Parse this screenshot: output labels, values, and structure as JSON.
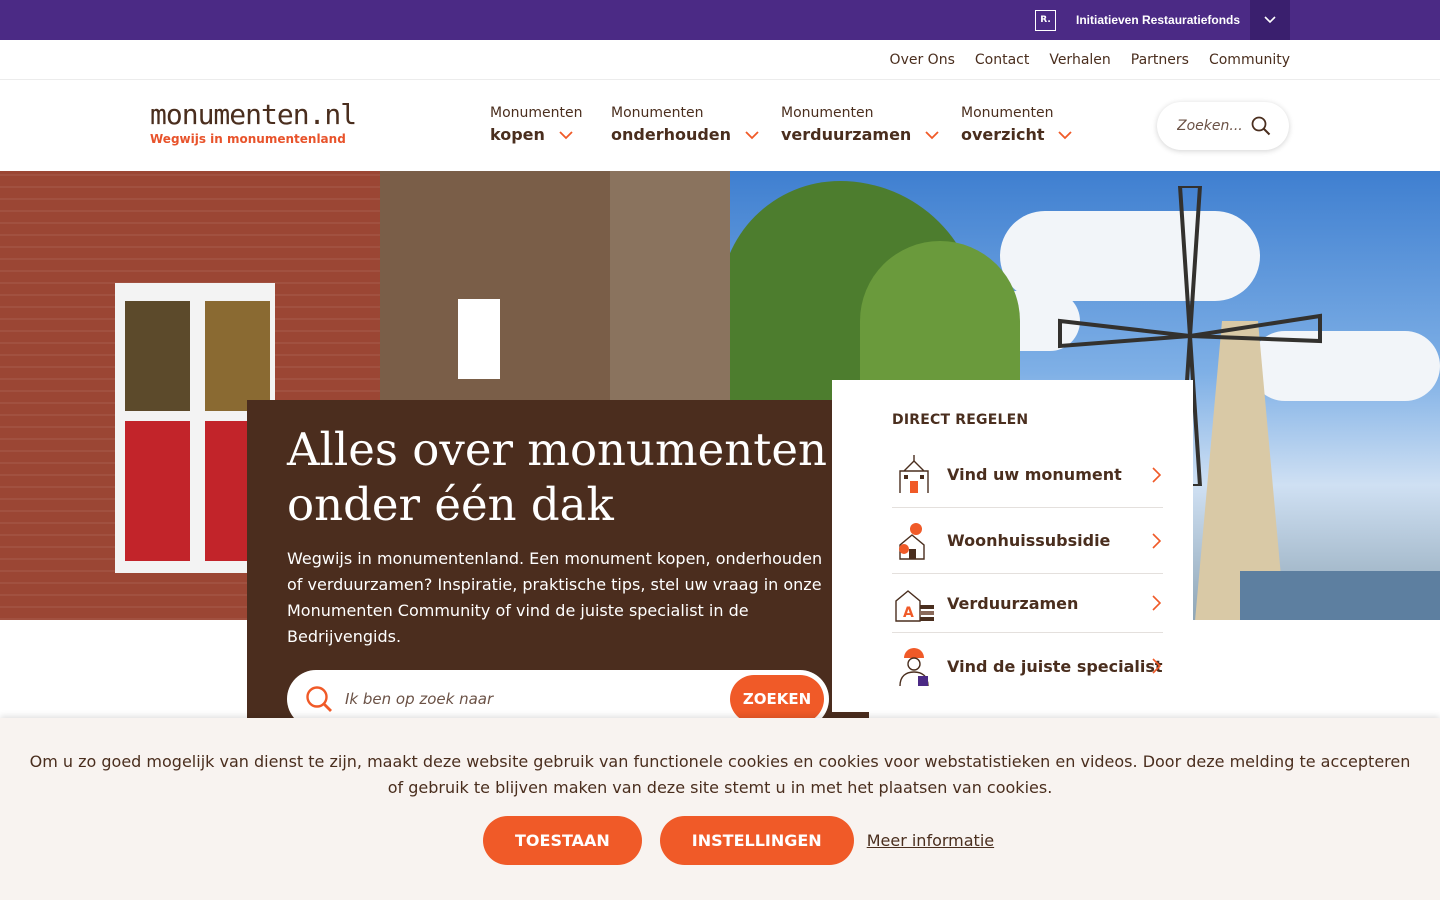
{
  "topbar": {
    "org_logo_text": "R.",
    "org_name": "Initiatieven Restauratiefonds",
    "toggle_icon": "chevron-down-icon"
  },
  "utility_nav": [
    "Over Ons",
    "Contact",
    "Verhalen",
    "Partners",
    "Community"
  ],
  "header": {
    "logo_text": "monumenten.nl",
    "logo_tagline": "Wegwijs in monumentenland",
    "nav": [
      {
        "small": "Monumenten",
        "big": "kopen"
      },
      {
        "small": "Monumenten",
        "big": "onderhouden"
      },
      {
        "small": "Monumenten",
        "big": "verduurzamen"
      },
      {
        "small": "Monumenten",
        "big": "overzicht"
      }
    ],
    "search_placeholder": "Zoeken..."
  },
  "hero": {
    "title": "Alles over monumenten onder één dak",
    "text": "Wegwijs in monumentenland. Een monument kopen, onderhouden of verduurzamen? Inspiratie, praktische tips, stel uw vraag in onze Monumenten Community of vind de juiste specialist in de Bedrijvengids.",
    "search_placeholder": "Ik ben op zoek naar",
    "search_button": "ZOEKEN"
  },
  "direct": {
    "title": "DIRECT REGELEN",
    "items": [
      {
        "label": "Vind uw monument",
        "icon": "monument-building-icon"
      },
      {
        "label": "Woonhuissubsidie",
        "icon": "subsidy-house-icon"
      },
      {
        "label": "Verduurzamen",
        "icon": "energy-label-icon"
      },
      {
        "label": "Vind de juiste specialist",
        "icon": "specialist-worker-icon"
      }
    ]
  },
  "cookie": {
    "text": "Om u zo goed mogelijk van dienst te zijn, maakt deze website gebruik van functionele cookies en cookies voor webstatistieken en videos. Door deze melding te accepteren of gebruik te blijven maken van deze site stemt u in met het plaatsen van cookies.",
    "accept": "TOESTAAN",
    "settings": "INSTELLINGEN",
    "more": "Meer informatie"
  },
  "colors": {
    "purple": "#4b2a85",
    "brown": "#4b2d1e",
    "orange": "#f05a28"
  }
}
